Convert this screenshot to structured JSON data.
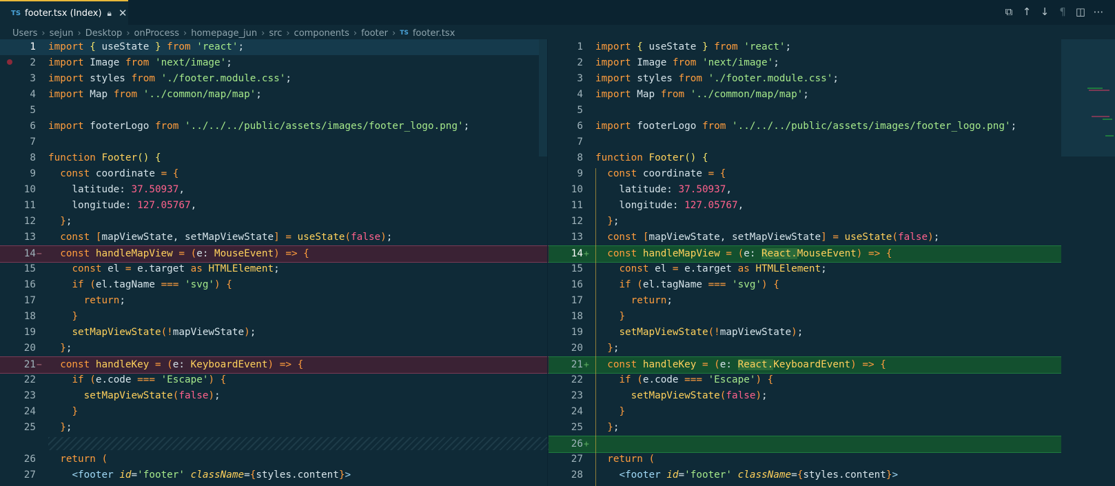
{
  "tab": {
    "lang": "TS",
    "title": "footer.tsx (Index)"
  },
  "actions": [
    {
      "name": "open-file-icon",
      "glyph": "⧉"
    },
    {
      "name": "previous-change-icon",
      "glyph": "↑"
    },
    {
      "name": "next-change-icon",
      "glyph": "↓"
    },
    {
      "name": "whitespace-icon",
      "glyph": "¶"
    },
    {
      "name": "split-editor-icon",
      "glyph": "◫"
    },
    {
      "name": "more-actions-icon",
      "glyph": "⋯"
    }
  ],
  "breadcrumb": [
    "Users",
    "sejun",
    "Desktop",
    "onProcess",
    "homepage_jun",
    "src",
    "components",
    "footer"
  ],
  "breadcrumb_file": {
    "lang": "TS",
    "name": "footer.tsx"
  },
  "left_numbers": [
    "1",
    "2",
    "3",
    "4",
    "5",
    "6",
    "7",
    "8",
    "9",
    "10",
    "11",
    "12",
    "13",
    "14",
    "15",
    "16",
    "17",
    "18",
    "19",
    "20",
    "21",
    "22",
    "23",
    "24",
    "25",
    "",
    "26",
    "27"
  ],
  "right_numbers": [
    "1",
    "2",
    "3",
    "4",
    "5",
    "6",
    "7",
    "8",
    "9",
    "10",
    "11",
    "12",
    "13",
    "14",
    "15",
    "16",
    "17",
    "18",
    "19",
    "20",
    "21",
    "22",
    "23",
    "24",
    "25",
    "26",
    "27",
    "28"
  ],
  "colors": {
    "deleted": "#3a2234",
    "inserted": "#13502f",
    "accent": "#e8b93a"
  }
}
